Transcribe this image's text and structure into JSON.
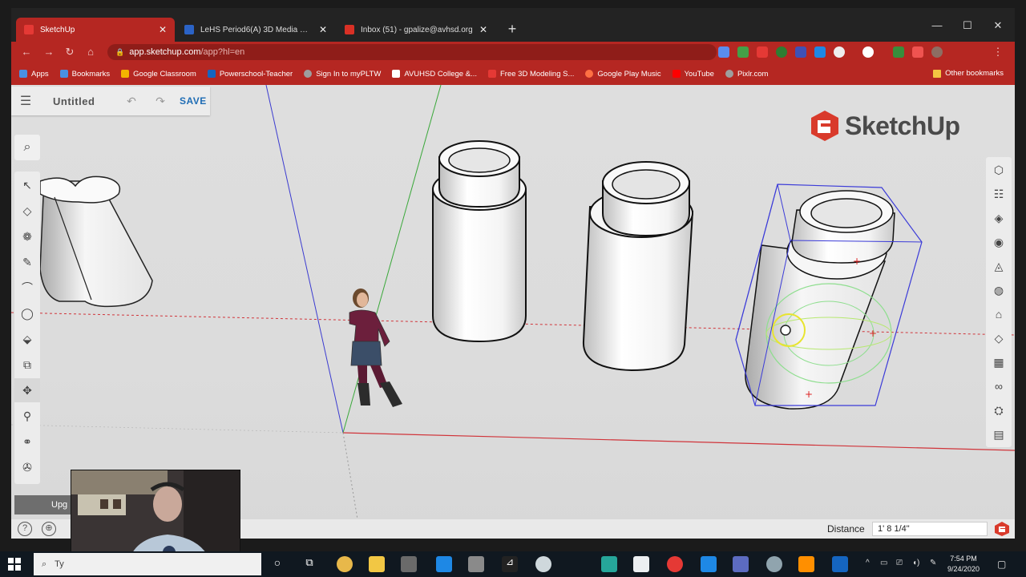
{
  "browser": {
    "tabs": [
      {
        "title": "SketchUp",
        "favicon_color": "#e53935",
        "active": true
      },
      {
        "title": "LeHS Period6(A) 3D Media Desi...",
        "favicon_color": "#2b63c6",
        "active": false
      },
      {
        "title": "Inbox (51) - gpalize@avhsd.org",
        "favicon_color": "#d93025",
        "active": false
      }
    ],
    "url": "app.sketchup.com",
    "url_path": "/app?hl=en",
    "bookmarks": [
      {
        "label": "Apps",
        "color": "#4a90e2"
      },
      {
        "label": "Bookmarks",
        "color": "#4a90e2"
      },
      {
        "label": "Google Classroom",
        "color": "#f4b400"
      },
      {
        "label": "Powerschool-Teacher",
        "color": "#1565c0"
      },
      {
        "label": "Sign In to myPLTW",
        "color": "#9e9e9e"
      },
      {
        "label": "AVUHSD College &...",
        "color": "#ffffff"
      },
      {
        "label": "Free 3D Modeling S...",
        "color": "#e53935"
      },
      {
        "label": "Google Play Music",
        "color": "#ff7043"
      },
      {
        "label": "YouTube",
        "color": "#ff0000"
      },
      {
        "label": "Pixlr.com",
        "color": "#9e9e9e"
      }
    ],
    "other_bookmarks": "Other bookmarks"
  },
  "sketchup": {
    "doc_title": "Untitled",
    "save_label": "SAVE",
    "logo_text": "SketchUp",
    "upgrade_label": "Upg",
    "distance_label": "Distance",
    "distance_value": "1' 8 1/4\""
  },
  "taskbar": {
    "search_placeholder": "Ty",
    "time": "7:54 PM",
    "date": "9/24/2020"
  }
}
